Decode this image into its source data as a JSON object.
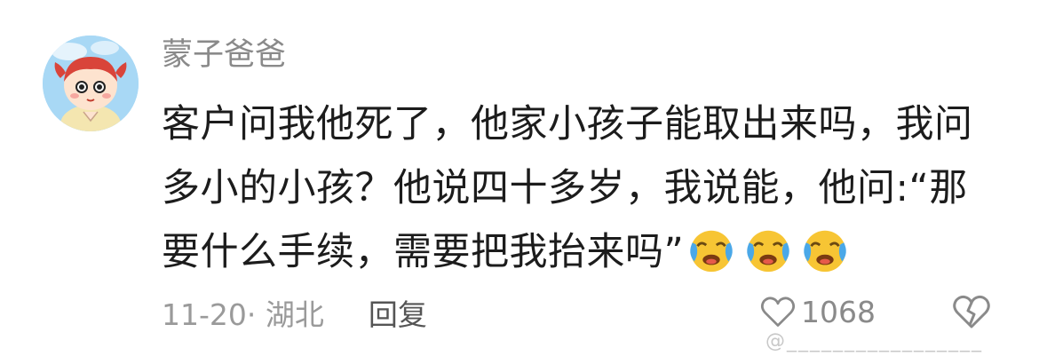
{
  "comment": {
    "username": "蒙子爸爸",
    "text": "客户问我他死了，他家小孩子能取出来吗，我问多小的小孩？他说四十多岁，我说能，他问:“那要什么手续，需要把我抬来吗”",
    "emojis": [
      "crying-laughing-icon",
      "crying-laughing-icon",
      "crying-laughing-icon"
    ],
    "date_location": "11-20· 湖北",
    "reply_label": "回复",
    "like_count": "1068"
  },
  "watermark": "@_________________",
  "colors": {
    "text": "#1c1c1c",
    "username": "#8a8a8a",
    "meta": "#9a9a9a",
    "avatar_bg": "#a8d8f5",
    "emoji_face": "#f7c534",
    "emoji_tear": "#4aa8e8"
  }
}
